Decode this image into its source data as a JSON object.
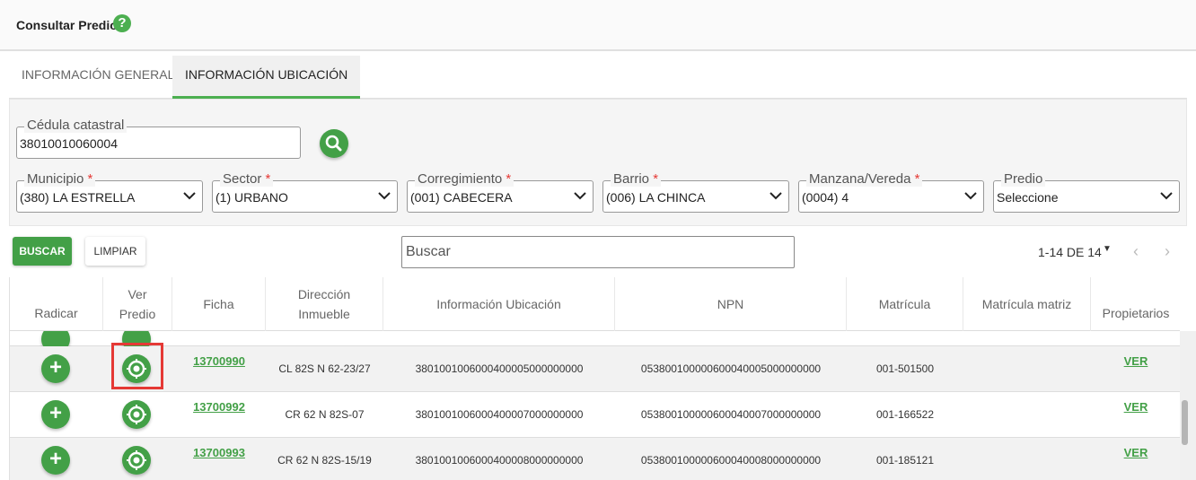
{
  "header": {
    "title": "Consultar Predio",
    "help_icon": "help-circle-icon"
  },
  "tabs": [
    {
      "label": "INFORMACIÓN GENERAL",
      "active": false
    },
    {
      "label": "INFORMACIÓN UBICACIÓN",
      "active": true
    }
  ],
  "filters": {
    "cedula": {
      "label": "Cédula catastral",
      "value": "38010010060004"
    },
    "municipio": {
      "label": "Municipio",
      "required": "*",
      "value": "(380) LA ESTRELLA"
    },
    "sector": {
      "label": "Sector",
      "required": "*",
      "value": "(1) URBANO"
    },
    "corregimiento": {
      "label": "Corregimiento",
      "required": "*",
      "value": "(001) CABECERA"
    },
    "barrio": {
      "label": "Barrio",
      "required": "*",
      "value": "(006) LA CHINCA"
    },
    "manzana": {
      "label": "Manzana/Vereda",
      "required": "*",
      "value": "(0004) 4"
    },
    "predio": {
      "label": "Predio",
      "value": "Seleccione"
    }
  },
  "actions": {
    "buscar": "BUSCAR",
    "limpiar": "LIMPIAR"
  },
  "search": {
    "placeholder": "Buscar"
  },
  "pager": {
    "text": "1-14 DE 14"
  },
  "table": {
    "headers": {
      "radicar": "Radicar",
      "ver_predio_1": "Ver",
      "ver_predio_2": "Predio",
      "ficha": "Ficha",
      "direccion_1": "Dirección",
      "direccion_2": "Inmueble",
      "info_ubicacion": "Información Ubicación",
      "npn": "NPN",
      "matricula": "Matrícula",
      "matricula_matriz": "Matrícula matriz",
      "propietarios": "Propietarios"
    },
    "rows": [
      {
        "ficha": "13700990",
        "direccion": "CL 82S N 62-23/27",
        "info": "3801001006000400005000000000",
        "npn": "053800100000600040005000000000",
        "matricula": "001-501500",
        "matricula_matriz": "",
        "propietarios": "VER"
      },
      {
        "ficha": "13700992",
        "direccion": "CR 62 N 82S-07",
        "info": "3801001006000400007000000000",
        "npn": "053800100000600040007000000000",
        "matricula": "001-166522",
        "matricula_matriz": "",
        "propietarios": "VER"
      },
      {
        "ficha": "13700993",
        "direccion": "CR 62 N 82S-15/19",
        "info": "3801001006000400008000000000",
        "npn": "053800100000600040008000000000",
        "matricula": "001-185121",
        "matricula_matriz": "",
        "propietarios": "VER"
      }
    ]
  },
  "colors": {
    "accent": "#43a047",
    "highlight": "#e53935"
  }
}
